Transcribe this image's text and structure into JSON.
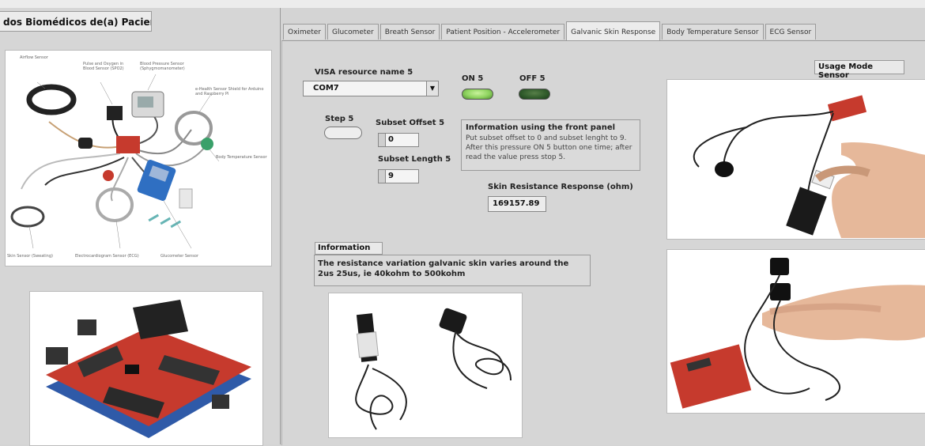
{
  "window": {
    "left_tab": "dos Biomédicos de(a) Paciente"
  },
  "tabs": [
    {
      "label": "Oximeter",
      "active": false
    },
    {
      "label": "Glucometer",
      "active": false
    },
    {
      "label": "Breath Sensor",
      "active": false
    },
    {
      "label": "Patient Position - Accelerometer",
      "active": false
    },
    {
      "label": "Galvanic Skin Response",
      "active": true
    },
    {
      "label": "Body Temperature Sensor",
      "active": false
    },
    {
      "label": "ECG Sensor",
      "active": false
    }
  ],
  "left_diagram": {
    "labels": [
      "Airflow Sensor",
      "Pulse and Oxygen in Blood Sensor (SPO2)",
      "Blood Pressure Sensor (Sphygmomanometer)",
      "e-Health Sensor Shield for Arduino and Raspberry Pi",
      "Body Temperature Sensor",
      "Electrocardiogram Sensor (ECG)",
      "Glucometer Sensor",
      "Skin Sensor (Sweating)"
    ]
  },
  "controls": {
    "visa_label": "VISA resource name 5",
    "visa_value": "COM7",
    "on_label": "ON 5",
    "off_label": "OFF 5",
    "step_label": "Step 5",
    "subset_offset_label": "Subset Offset 5",
    "subset_offset_value": "0",
    "subset_length_label": "Subset Length 5",
    "subset_length_value": "9",
    "info_title": "Information using the front panel",
    "info_text": "Put subset offset to 0 and subset lenght to 9. After this pressure ON 5 button one time; after read the value press stop 5.",
    "resistance_label": "Skin Resistance Response (ohm)",
    "resistance_value": "169157.89",
    "information_label": "Information",
    "information_text": "The resistance variation galvanic skin varies around the 2us 25us, ie 40kohm to 500kohm",
    "usage_mode_label": "Usage Mode Sensor"
  },
  "colors": {
    "panel_bg": "#d6d6d6",
    "led_on": "#8ed35f",
    "led_off": "#2f5a2a",
    "board_red": "#c63a2d"
  }
}
